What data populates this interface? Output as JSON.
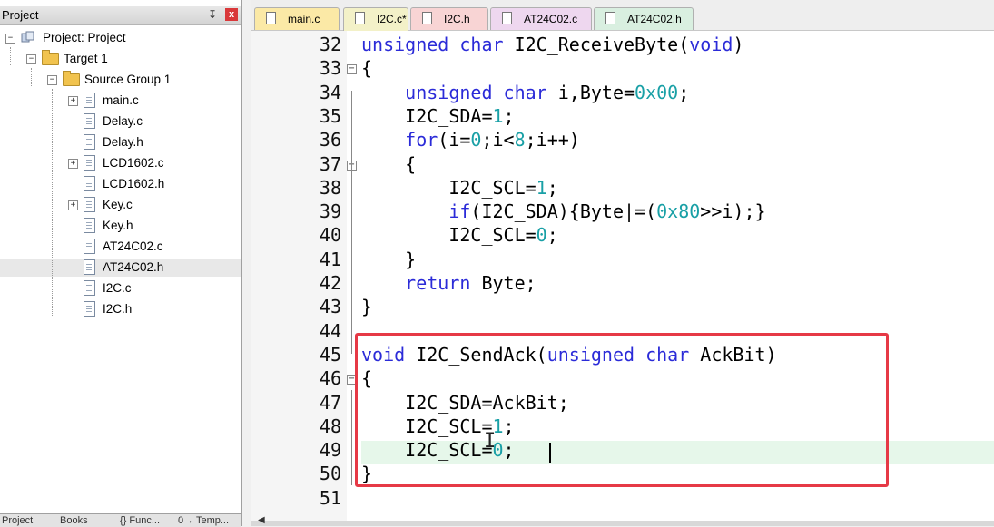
{
  "project_panel": {
    "title": "Project",
    "pin_glyph": "↧",
    "close_glyph": "x",
    "tree": [
      {
        "label": "Project: Project",
        "expander": "−",
        "icon": "project-icon"
      },
      {
        "label": "Target 1",
        "expander": "−",
        "icon": "target-icon"
      },
      {
        "label": "Source Group 1",
        "expander": "−",
        "icon": "folder-icon"
      },
      {
        "label": "main.c",
        "expander": "+",
        "icon": "file-icon"
      },
      {
        "label": "Delay.c",
        "icon": "file-icon"
      },
      {
        "label": "Delay.h",
        "icon": "file-icon"
      },
      {
        "label": "LCD1602.c",
        "expander": "+",
        "icon": "file-icon"
      },
      {
        "label": "LCD1602.h",
        "icon": "file-icon"
      },
      {
        "label": "Key.c",
        "expander": "+",
        "icon": "file-icon"
      },
      {
        "label": "Key.h",
        "icon": "file-icon"
      },
      {
        "label": "AT24C02.c",
        "icon": "file-icon"
      },
      {
        "label": "AT24C02.h",
        "icon": "file-icon",
        "selected": true
      },
      {
        "label": "I2C.c",
        "icon": "file-icon"
      },
      {
        "label": "I2C.h",
        "icon": "file-icon"
      }
    ],
    "bottom_tabs": [
      "Project",
      "Books",
      "{} Func...",
      "0→ Temp..."
    ]
  },
  "editor": {
    "tabs": [
      {
        "label": "main.c",
        "color": "#fbe9a6",
        "active": false
      },
      {
        "label": "I2C.c*",
        "color": "#f3f1c8",
        "active": true
      },
      {
        "label": "I2C.h",
        "color": "#f8d4d4",
        "active": false
      },
      {
        "label": "AT24C02.c",
        "color": "#eed7ef",
        "active": false
      },
      {
        "label": "AT24C02.h",
        "color": "#d9efe0",
        "active": false
      }
    ],
    "lines": [
      {
        "n": "32",
        "code": "<span class=\"kw\">unsigned char</span> I2C_ReceiveByte(<span class=\"kw\">void</span>)"
      },
      {
        "n": "33",
        "code": "{",
        "fold": "−"
      },
      {
        "n": "34",
        "code": "    <span class=\"kw\">unsigned char</span> i,Byte=<span class=\"num\">0x00</span>;"
      },
      {
        "n": "35",
        "code": "    I2C_SDA=<span class=\"num\">1</span>;"
      },
      {
        "n": "36",
        "code": "    <span class=\"kw\">for</span>(i=<span class=\"num\">0</span>;i&lt;<span class=\"num\">8</span>;i++)"
      },
      {
        "n": "37",
        "code": "    {",
        "fold": "−"
      },
      {
        "n": "38",
        "code": "        I2C_SCL=<span class=\"num\">1</span>;"
      },
      {
        "n": "39",
        "code": "        <span class=\"kw\">if</span>(I2C_SDA){Byte|=(<span class=\"num\">0x80</span>&gt;&gt;i);}"
      },
      {
        "n": "40",
        "code": "        I2C_SCL=<span class=\"num\">0</span>;"
      },
      {
        "n": "41",
        "code": "    }"
      },
      {
        "n": "42",
        "code": "    <span class=\"kw\">return</span> Byte;"
      },
      {
        "n": "43",
        "code": "}"
      },
      {
        "n": "44",
        "code": ""
      },
      {
        "n": "45",
        "code": "<span class=\"kw\">void</span> I2C_SendAck(<span class=\"kw\">unsigned char</span> AckBit)"
      },
      {
        "n": "46",
        "code": "{",
        "fold": "−"
      },
      {
        "n": "47",
        "code": "    I2C_SDA=AckBit;"
      },
      {
        "n": "48",
        "code": "    I2C_SCL=<span class=\"num\">1</span>;"
      },
      {
        "n": "49",
        "code": "    I2C_SCL=<span class=\"num\">0</span>;",
        "current": true
      },
      {
        "n": "50",
        "code": "}"
      },
      {
        "n": "51",
        "code": ""
      }
    ],
    "highlight_box_color": "#e63946",
    "keyword_color": "#2b2bd8",
    "number_color": "#19a0a6"
  }
}
